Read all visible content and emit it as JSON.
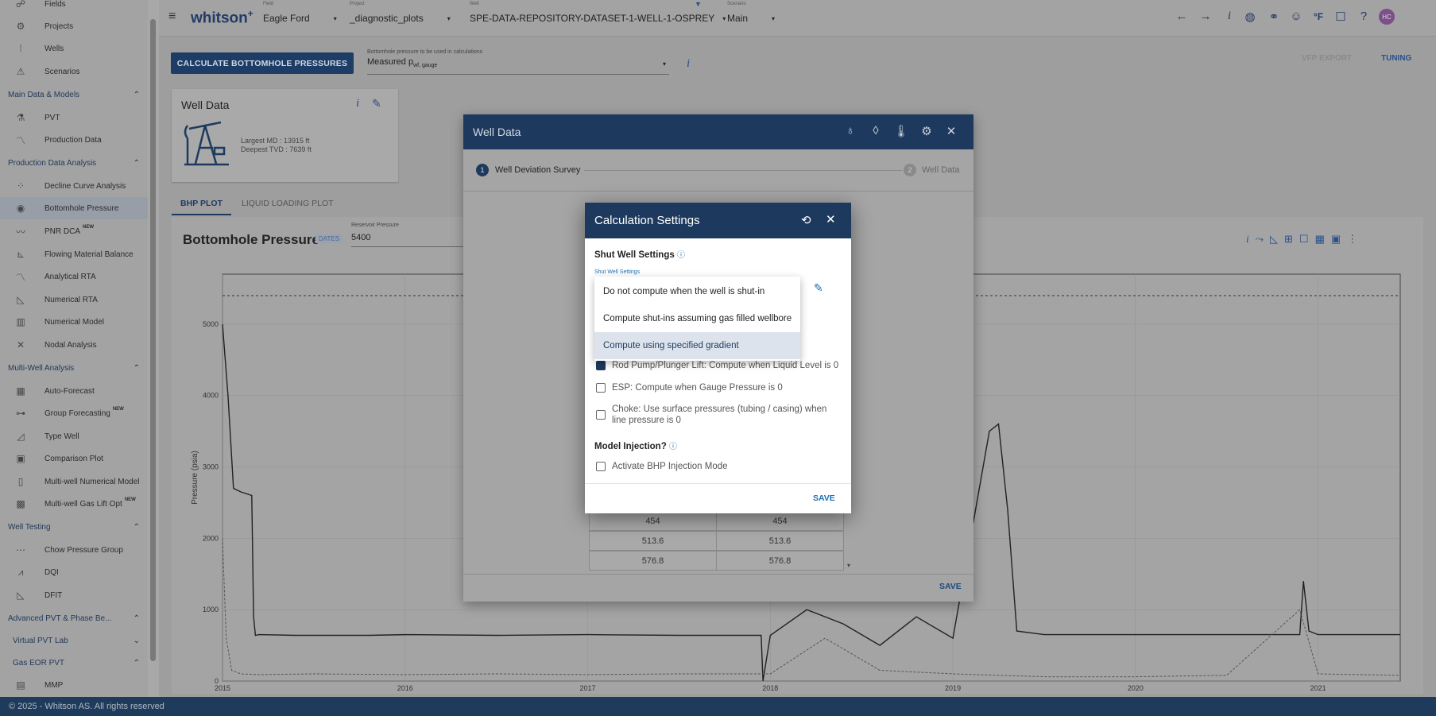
{
  "app": {
    "logo": "whitson",
    "logo_plus": "+",
    "footer": "© 2025 - Whitson AS. All rights reserved"
  },
  "topbar": {
    "field": {
      "caption": "Field",
      "value": "Eagle Ford"
    },
    "project": {
      "caption": "Project",
      "value": "_diagnostic_plots"
    },
    "well": {
      "caption": "Well",
      "value": "SPE-DATA-REPOSITORY-DATASET-1-WELL-1-OSPREY"
    },
    "scenario": {
      "caption": "Scenario",
      "value": "Main"
    },
    "icons": [
      "arrow-left-icon",
      "arrow-right-icon",
      "info-icon",
      "globe-icon",
      "link-icon",
      "user-circle-icon",
      "temperature-unit-icon",
      "feedback-icon",
      "help-icon",
      "avatar"
    ],
    "temp_unit": "°F",
    "avatar_initials": "HC"
  },
  "sidebar": {
    "items": [
      {
        "type": "item",
        "label": "Fields",
        "icon": "☍"
      },
      {
        "type": "item",
        "label": "Projects",
        "icon": "⚙"
      },
      {
        "type": "item",
        "label": "Wells",
        "icon": "⁞"
      },
      {
        "type": "item",
        "label": "Scenarios",
        "icon": "⚠"
      },
      {
        "type": "section",
        "label": "Main Data & Models"
      },
      {
        "type": "item",
        "label": "PVT",
        "icon": "⚗"
      },
      {
        "type": "item",
        "label": "Production Data",
        "icon": "〽"
      },
      {
        "type": "section",
        "label": "Production Data Analysis"
      },
      {
        "type": "item",
        "label": "Decline Curve Analysis",
        "icon": "⁘"
      },
      {
        "type": "item",
        "label": "Bottomhole Pressure",
        "icon": "◉",
        "active": true
      },
      {
        "type": "item",
        "label": "PNR DCA",
        "icon": "〰",
        "badge": "NEW"
      },
      {
        "type": "item",
        "label": "Flowing Material Balance",
        "icon": "⊾"
      },
      {
        "type": "item",
        "label": "Analytical RTA",
        "icon": "〽"
      },
      {
        "type": "item",
        "label": "Numerical RTA",
        "icon": "◺"
      },
      {
        "type": "item",
        "label": "Numerical Model",
        "icon": "▥"
      },
      {
        "type": "item",
        "label": "Nodal Analysis",
        "icon": "✕"
      },
      {
        "type": "section",
        "label": "Multi-Well Analysis"
      },
      {
        "type": "item",
        "label": "Auto-Forecast",
        "icon": "▦"
      },
      {
        "type": "item",
        "label": "Group Forecasting",
        "icon": "⊶",
        "badge": "NEW"
      },
      {
        "type": "item",
        "label": "Type Well",
        "icon": "◿"
      },
      {
        "type": "item",
        "label": "Comparison Plot",
        "icon": "▣"
      },
      {
        "type": "item",
        "label": "Multi-well Numerical Model",
        "icon": "▯"
      },
      {
        "type": "item",
        "label": "Multi-well Gas Lift Opt",
        "icon": "▩",
        "badge": "NEW"
      },
      {
        "type": "section",
        "label": "Well Testing"
      },
      {
        "type": "item",
        "label": "Chow Pressure Group",
        "icon": "⋯"
      },
      {
        "type": "item",
        "label": "DQI",
        "icon": "⩘"
      },
      {
        "type": "item",
        "label": "DFIT",
        "icon": "◺"
      },
      {
        "type": "section",
        "label": "Advanced PVT & Phase Be..."
      },
      {
        "type": "subsection",
        "label": "Virtual PVT Lab",
        "chev": "down"
      },
      {
        "type": "subsection",
        "label": "Gas EOR PVT",
        "chev": "up"
      },
      {
        "type": "item",
        "label": "MMP",
        "icon": "▤"
      }
    ]
  },
  "toolbar": {
    "calc_button": "CALCULATE BOTTOMHOLE PRESSURES",
    "bp_caption": "Bottomhole pressure to be used in calculations",
    "bp_value": "Measured p",
    "bp_sub": "wf, gauge",
    "vfp_export": "VFP EXPORT",
    "tuning": "TUNING"
  },
  "well_card": {
    "title": "Well Data",
    "largest_md": "Largest MD :  13915 ft",
    "deepest_tvd": "Deepest TVD :  7639 ft"
  },
  "tabs": [
    {
      "label": "BHP PLOT",
      "active": true
    },
    {
      "label": "LIQUID LOADING PLOT",
      "active": false
    }
  ],
  "chart_header": {
    "title": "Bottomhole Pressure",
    "dates_badge": "DATES",
    "res_caption": "Reservoir Pressure",
    "res_value": "5400",
    "res_unit": "psi"
  },
  "chart_data": {
    "type": "line",
    "ylabel": "Pressure (psia)",
    "xlabel": "",
    "x_ticks": [
      "2015",
      "2016",
      "2017",
      "2018",
      "2019",
      "2020",
      "2021"
    ],
    "y_ticks": [
      0,
      1000,
      2000,
      3000,
      4000,
      5000
    ],
    "ylim": [
      0,
      5700
    ],
    "xlim": [
      2015.0,
      2021.45
    ],
    "reservoir_pressure": 5400,
    "series": [
      {
        "values_x": [
          2015.0,
          2015.03,
          2015.06,
          2015.1,
          2015.16,
          2015.17,
          2015.18,
          2015.2,
          2015.4,
          2015.6,
          2015.8,
          2016.0,
          2016.5,
          2017.0,
          2017.5,
          2017.95,
          2017.96,
          2018.0,
          2018.2,
          2018.4,
          2018.6,
          2018.8,
          2019.0,
          2019.2,
          2019.25,
          2019.3,
          2019.35,
          2019.5,
          2019.8,
          2020.0,
          2020.5,
          2020.9,
          2020.92,
          2020.95,
          2021.0,
          2021.2,
          2021.45
        ],
        "values_y": [
          5000,
          4000,
          2700,
          2650,
          2600,
          900,
          640,
          650,
          640,
          640,
          640,
          650,
          640,
          650,
          640,
          640,
          0,
          640,
          1000,
          800,
          500,
          900,
          600,
          3500,
          3600,
          2400,
          700,
          650,
          650,
          650,
          650,
          650,
          1400,
          700,
          650,
          650,
          650
        ]
      },
      {
        "values_x": [
          2015.0,
          2015.02,
          2015.05,
          2015.1,
          2015.2,
          2015.5,
          2016.0,
          2016.5,
          2017.0,
          2017.5,
          2018.0,
          2018.3,
          2018.6,
          2019.0,
          2019.5,
          2020.0,
          2020.5,
          2020.9,
          2021.0,
          2021.45
        ],
        "values_y": [
          2000,
          600,
          150,
          100,
          90,
          100,
          90,
          100,
          90,
          100,
          100,
          600,
          150,
          100,
          60,
          60,
          80,
          1000,
          100,
          80
        ]
      }
    ]
  },
  "wd_modal": {
    "title": "Well Data",
    "icons": [
      "oil-drop-info-icon",
      "drop-icon",
      "thermometer-icon",
      "gear-icon",
      "close-icon"
    ],
    "step1": "Well Deviation Survey",
    "step1_num": "1",
    "step2": "Well Data",
    "step2_num": "2",
    "table_rows": [
      [
        "454",
        "454"
      ],
      [
        "513.6",
        "513.6"
      ],
      [
        "576.8",
        "576.8"
      ]
    ],
    "save": "SAVE"
  },
  "calc_modal": {
    "title": "Calculation Settings",
    "shut_section": "Shut Well Settings",
    "shut_caption": "Shut Well Settings",
    "options_behind": "Rod Pump/Plunger Lift: Compute when Liquid Level is 0",
    "esp": "ESP: Compute when Gauge Pressure is 0",
    "choke": "Choke: Use surface pressures (tubing / casing) when line pressure is 0",
    "injection_section": "Model Injection?",
    "injection_label": "Activate BHP Injection Mode",
    "save": "SAVE"
  },
  "dropdown": {
    "options": [
      "Do not compute when the well is shut-in",
      "Compute shut-ins assuming gas filled wellbore",
      "Compute using specified gradient"
    ],
    "selected_index": 2
  },
  "colors": {
    "primary": "#1d3a5e",
    "accent": "#1a6fb5"
  }
}
